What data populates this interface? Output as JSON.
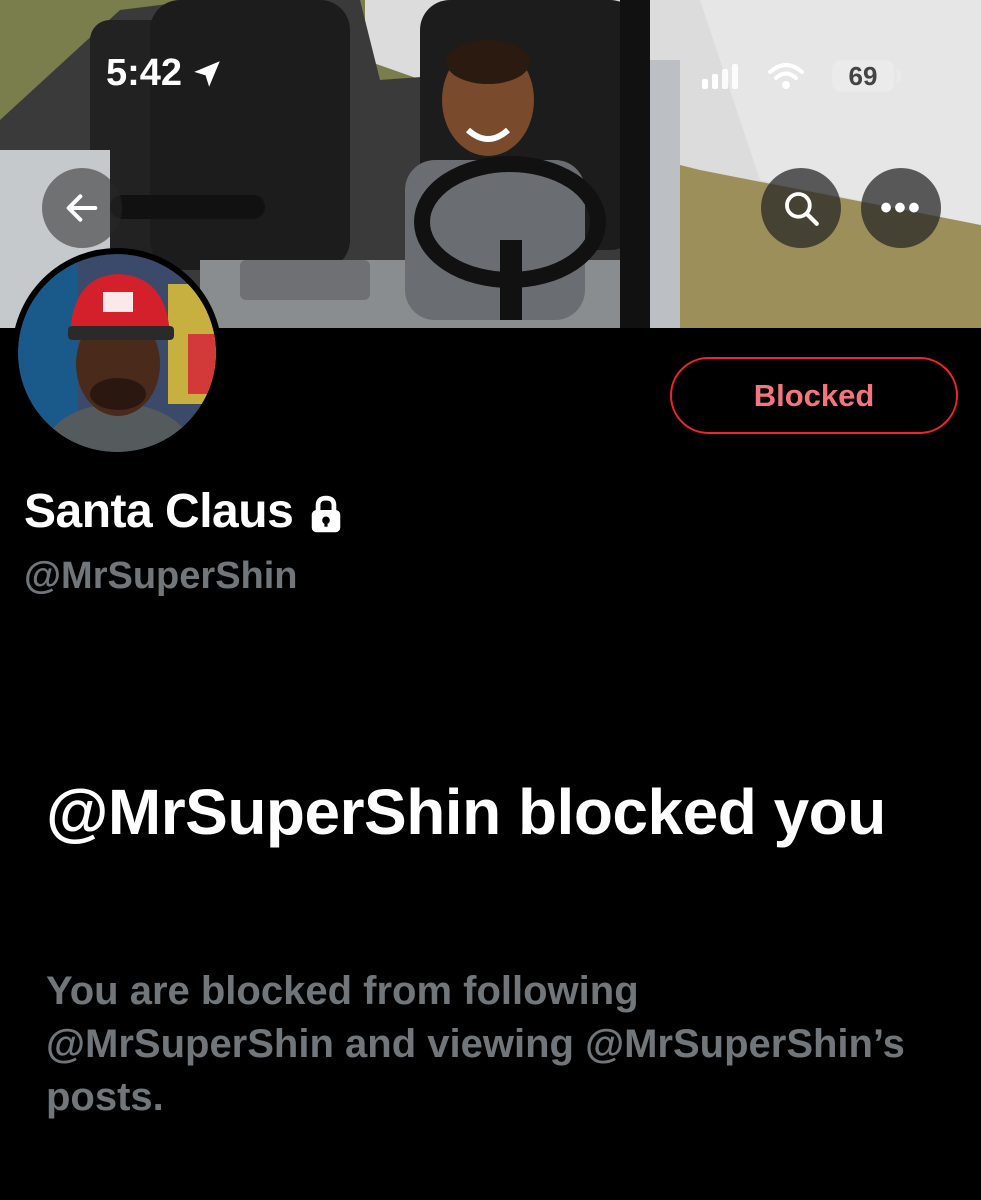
{
  "status_bar": {
    "time": "5:42",
    "battery": "69"
  },
  "header": {
    "back_icon": "arrow-left-icon",
    "search_icon": "search-icon",
    "more_label": "•••"
  },
  "profile": {
    "display_name": "Santa Claus",
    "handle": "@MrSuperShin",
    "protected_icon": "lock-icon",
    "blocked_button_label": "Blocked"
  },
  "block_notice": {
    "title": "@MrSuperShin blocked you",
    "description": "You are blocked from following @MrSuperShin and viewing @MrSuperShin’s posts."
  },
  "colors": {
    "background": "#000000",
    "primary_text": "#ffffff",
    "secondary_text": "#71767b",
    "blocked_red": "#f4212e"
  }
}
